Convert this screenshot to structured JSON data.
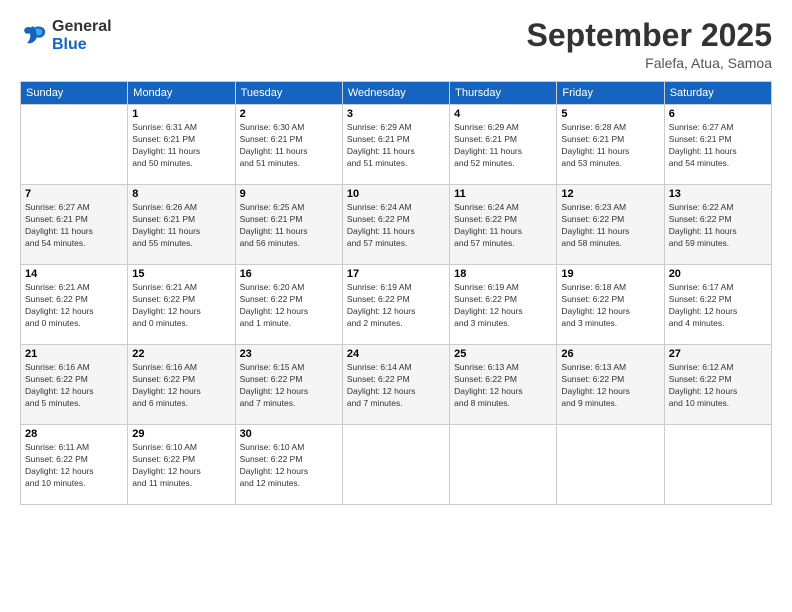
{
  "logo": {
    "general": "General",
    "blue": "Blue"
  },
  "header": {
    "month": "September 2025",
    "location": "Falefa, Atua, Samoa"
  },
  "weekdays": [
    "Sunday",
    "Monday",
    "Tuesday",
    "Wednesday",
    "Thursday",
    "Friday",
    "Saturday"
  ],
  "weeks": [
    [
      {
        "day": "",
        "info": ""
      },
      {
        "day": "1",
        "info": "Sunrise: 6:31 AM\nSunset: 6:21 PM\nDaylight: 11 hours\nand 50 minutes."
      },
      {
        "day": "2",
        "info": "Sunrise: 6:30 AM\nSunset: 6:21 PM\nDaylight: 11 hours\nand 51 minutes."
      },
      {
        "day": "3",
        "info": "Sunrise: 6:29 AM\nSunset: 6:21 PM\nDaylight: 11 hours\nand 51 minutes."
      },
      {
        "day": "4",
        "info": "Sunrise: 6:29 AM\nSunset: 6:21 PM\nDaylight: 11 hours\nand 52 minutes."
      },
      {
        "day": "5",
        "info": "Sunrise: 6:28 AM\nSunset: 6:21 PM\nDaylight: 11 hours\nand 53 minutes."
      },
      {
        "day": "6",
        "info": "Sunrise: 6:27 AM\nSunset: 6:21 PM\nDaylight: 11 hours\nand 54 minutes."
      }
    ],
    [
      {
        "day": "7",
        "info": "Sunrise: 6:27 AM\nSunset: 6:21 PM\nDaylight: 11 hours\nand 54 minutes."
      },
      {
        "day": "8",
        "info": "Sunrise: 6:26 AM\nSunset: 6:21 PM\nDaylight: 11 hours\nand 55 minutes."
      },
      {
        "day": "9",
        "info": "Sunrise: 6:25 AM\nSunset: 6:21 PM\nDaylight: 11 hours\nand 56 minutes."
      },
      {
        "day": "10",
        "info": "Sunrise: 6:24 AM\nSunset: 6:22 PM\nDaylight: 11 hours\nand 57 minutes."
      },
      {
        "day": "11",
        "info": "Sunrise: 6:24 AM\nSunset: 6:22 PM\nDaylight: 11 hours\nand 57 minutes."
      },
      {
        "day": "12",
        "info": "Sunrise: 6:23 AM\nSunset: 6:22 PM\nDaylight: 11 hours\nand 58 minutes."
      },
      {
        "day": "13",
        "info": "Sunrise: 6:22 AM\nSunset: 6:22 PM\nDaylight: 11 hours\nand 59 minutes."
      }
    ],
    [
      {
        "day": "14",
        "info": "Sunrise: 6:21 AM\nSunset: 6:22 PM\nDaylight: 12 hours\nand 0 minutes."
      },
      {
        "day": "15",
        "info": "Sunrise: 6:21 AM\nSunset: 6:22 PM\nDaylight: 12 hours\nand 0 minutes."
      },
      {
        "day": "16",
        "info": "Sunrise: 6:20 AM\nSunset: 6:22 PM\nDaylight: 12 hours\nand 1 minute."
      },
      {
        "day": "17",
        "info": "Sunrise: 6:19 AM\nSunset: 6:22 PM\nDaylight: 12 hours\nand 2 minutes."
      },
      {
        "day": "18",
        "info": "Sunrise: 6:19 AM\nSunset: 6:22 PM\nDaylight: 12 hours\nand 3 minutes."
      },
      {
        "day": "19",
        "info": "Sunrise: 6:18 AM\nSunset: 6:22 PM\nDaylight: 12 hours\nand 3 minutes."
      },
      {
        "day": "20",
        "info": "Sunrise: 6:17 AM\nSunset: 6:22 PM\nDaylight: 12 hours\nand 4 minutes."
      }
    ],
    [
      {
        "day": "21",
        "info": "Sunrise: 6:16 AM\nSunset: 6:22 PM\nDaylight: 12 hours\nand 5 minutes."
      },
      {
        "day": "22",
        "info": "Sunrise: 6:16 AM\nSunset: 6:22 PM\nDaylight: 12 hours\nand 6 minutes."
      },
      {
        "day": "23",
        "info": "Sunrise: 6:15 AM\nSunset: 6:22 PM\nDaylight: 12 hours\nand 7 minutes."
      },
      {
        "day": "24",
        "info": "Sunrise: 6:14 AM\nSunset: 6:22 PM\nDaylight: 12 hours\nand 7 minutes."
      },
      {
        "day": "25",
        "info": "Sunrise: 6:13 AM\nSunset: 6:22 PM\nDaylight: 12 hours\nand 8 minutes."
      },
      {
        "day": "26",
        "info": "Sunrise: 6:13 AM\nSunset: 6:22 PM\nDaylight: 12 hours\nand 9 minutes."
      },
      {
        "day": "27",
        "info": "Sunrise: 6:12 AM\nSunset: 6:22 PM\nDaylight: 12 hours\nand 10 minutes."
      }
    ],
    [
      {
        "day": "28",
        "info": "Sunrise: 6:11 AM\nSunset: 6:22 PM\nDaylight: 12 hours\nand 10 minutes."
      },
      {
        "day": "29",
        "info": "Sunrise: 6:10 AM\nSunset: 6:22 PM\nDaylight: 12 hours\nand 11 minutes."
      },
      {
        "day": "30",
        "info": "Sunrise: 6:10 AM\nSunset: 6:22 PM\nDaylight: 12 hours\nand 12 minutes."
      },
      {
        "day": "",
        "info": ""
      },
      {
        "day": "",
        "info": ""
      },
      {
        "day": "",
        "info": ""
      },
      {
        "day": "",
        "info": ""
      }
    ]
  ]
}
